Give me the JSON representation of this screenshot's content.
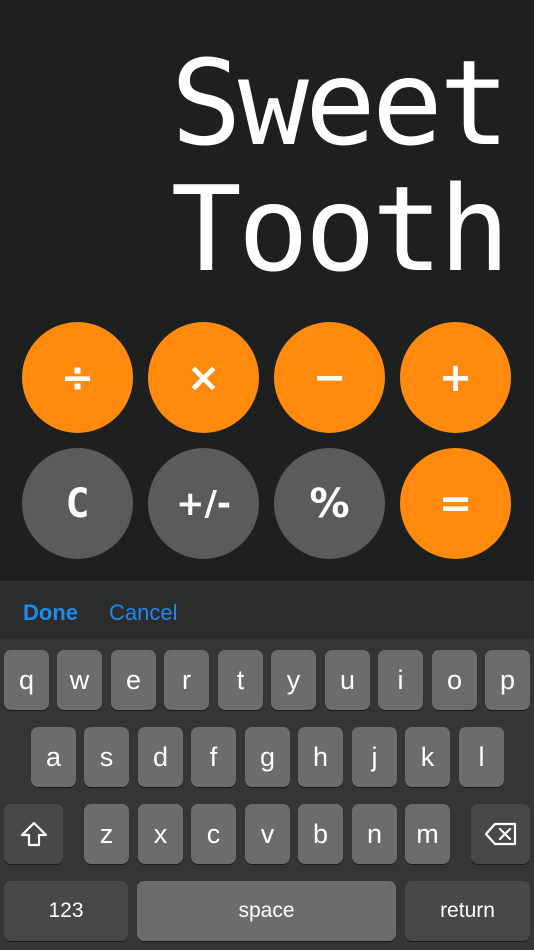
{
  "display": {
    "line1": "Sweet",
    "line2": "Tooth"
  },
  "calculator": {
    "operators": [
      {
        "label": "÷",
        "name": "divide-button"
      },
      {
        "label": "×",
        "name": "multiply-button"
      },
      {
        "label": "−",
        "name": "subtract-button"
      },
      {
        "label": "+",
        "name": "add-button"
      }
    ],
    "functions": [
      {
        "label": "C",
        "name": "clear-button"
      },
      {
        "label": "+/-",
        "name": "sign-toggle-button"
      },
      {
        "label": "%",
        "name": "percent-button"
      },
      {
        "label": "=",
        "name": "equals-button"
      }
    ]
  },
  "accessory": {
    "done_label": "Done",
    "cancel_label": "Cancel"
  },
  "keyboard": {
    "row1": [
      "q",
      "w",
      "e",
      "r",
      "t",
      "y",
      "u",
      "i",
      "o",
      "p"
    ],
    "row2": [
      "a",
      "s",
      "d",
      "f",
      "g",
      "h",
      "j",
      "k",
      "l"
    ],
    "row3": [
      "z",
      "x",
      "c",
      "v",
      "b",
      "n",
      "m"
    ],
    "shift_icon": "shift-icon",
    "delete_icon": "delete-icon",
    "numbers_label": "123",
    "space_label": "space",
    "return_label": "return"
  },
  "colors": {
    "operator_orange": "#ff8a0e",
    "function_gray": "#5b5b5b",
    "accent_blue": "#1d8af0"
  }
}
